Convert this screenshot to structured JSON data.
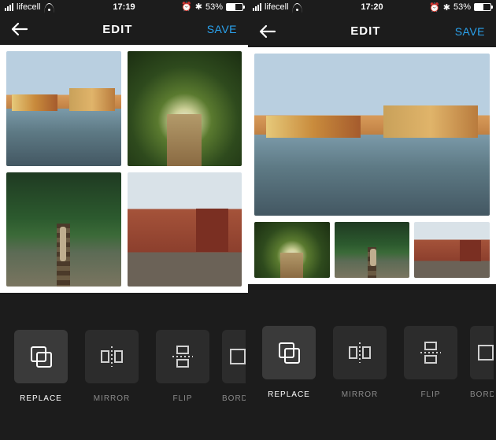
{
  "status": {
    "carrier": "lifecell",
    "battery_pct": "53%",
    "alarm_glyph": "⏰",
    "bt_glyph": "✱"
  },
  "screens": [
    {
      "time": "17:19",
      "nav": {
        "title": "EDIT",
        "save": "SAVE"
      },
      "tools": [
        {
          "label": "REPLACE",
          "selected": true,
          "icon": "replace"
        },
        {
          "label": "MIRROR",
          "selected": false,
          "icon": "mirror"
        },
        {
          "label": "FLIP",
          "selected": false,
          "icon": "flip"
        },
        {
          "label": "BORDER",
          "selected": false,
          "icon": "border",
          "cut": true
        }
      ],
      "layout": "grid2x2",
      "tiles": [
        "river",
        "trees",
        "rail",
        "brick"
      ]
    },
    {
      "time": "17:20",
      "nav": {
        "title": "EDIT",
        "save": "SAVE"
      },
      "tools": [
        {
          "label": "REPLACE",
          "selected": true,
          "icon": "replace"
        },
        {
          "label": "MIRROR",
          "selected": false,
          "icon": "mirror"
        },
        {
          "label": "FLIP",
          "selected": false,
          "icon": "flip"
        },
        {
          "label": "BORDER",
          "selected": false,
          "icon": "border",
          "cut": true
        }
      ],
      "layout": "hero+3",
      "hero": "river",
      "tiles": [
        "trees",
        "rail",
        "brick"
      ]
    }
  ]
}
